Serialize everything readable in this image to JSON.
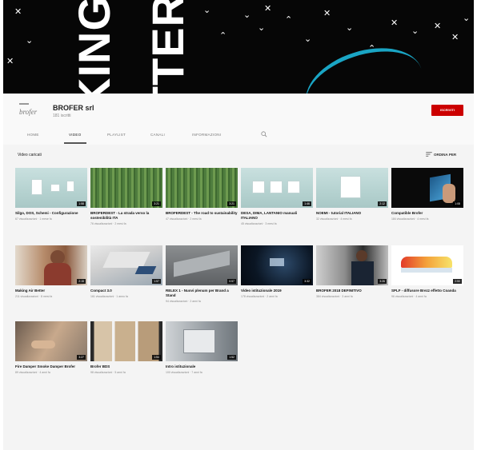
{
  "banner": {
    "text_left": "KING",
    "text_right": "TTER",
    "accent": "#1aa5c4"
  },
  "channel": {
    "logo_text": "brofer",
    "name": "BROFER srl",
    "subscribers": "181 iscritti",
    "subscribe_label": "ISCRIVITI",
    "subscribe_color": "#cc0000"
  },
  "tabs": [
    {
      "label": "HOME"
    },
    {
      "label": "VIDEO"
    },
    {
      "label": "PLAYLIST"
    },
    {
      "label": "CANALI"
    },
    {
      "label": "INFORMAZIONI"
    }
  ],
  "active_tab": "VIDEO",
  "section": {
    "title": "Video caricati",
    "sort_label": "ORDINA PER"
  },
  "videos": [
    {
      "title": "Silgo, DOS, Schemi - Configurazione",
      "meta": "67 visualizzazioni · 1 mese fa",
      "duration": "1:58",
      "thumb": "teal"
    },
    {
      "title": "BROFERDEST - La strada verso la sostenibilità ITA",
      "meta": "76 visualizzazioni · 2 mesi fa",
      "duration": "3:21",
      "thumb": "green"
    },
    {
      "title": "BROFERDEST - The road to sustainability",
      "meta": "47 visualizzazioni · 2 mesi fa",
      "duration": "3:21",
      "thumb": "green"
    },
    {
      "title": "DESA, DIMA, LANTANIO manuali ITALIANO",
      "meta": "45 visualizzazioni · 3 mesi fa",
      "duration": "1:46",
      "thumb": "teal"
    },
    {
      "title": "NOEMI - tutorial ITALIANO",
      "meta": "32 visualizzazioni · 4 mesi fa",
      "duration": "2:12",
      "thumb": "teal"
    },
    {
      "title": "Compatible Brofer",
      "meta": "184 visualizzazioni · 4 mesi fa",
      "duration": "1:08",
      "thumb": "dark"
    },
    {
      "title": "Making Air Better",
      "meta": "211 visualizzazioni · 8 mesi fa",
      "duration": "2:15",
      "thumb": "room"
    },
    {
      "title": "Compact 3.0",
      "meta": "161 visualizzazioni · 1 anno fa",
      "duration": "1:57",
      "thumb": "iso"
    },
    {
      "title": "RELEX 1 - Nuovi plenum per Brand a Stand",
      "meta": "94 visualizzazioni · 2 anni fa",
      "duration": "0:57",
      "thumb": "grey"
    },
    {
      "title": "Video istituzionale 2019",
      "meta": "178 visualizzazioni · 2 anni fa",
      "duration": "3:32",
      "thumb": "night"
    },
    {
      "title": "BROFER 2018 DEFINITIVO",
      "meta": "384 visualizzazioni · 3 anni fa",
      "duration": "3:26",
      "thumb": "lab"
    },
    {
      "title": "SPLF - diffusore Brezz effetto Coanda",
      "meta": "96 visualizzazioni · 4 anni fa",
      "duration": "2:50",
      "thumb": "white"
    },
    {
      "title": "Fire Damper Smoke Damper Brofer",
      "meta": "89 visualizzazioni · 4 anni fa",
      "duration": "3:27",
      "thumb": "hands"
    },
    {
      "title": "Brofer BDS",
      "meta": "98 visualizzazioni · 5 anni fa",
      "duration": "1:54",
      "thumb": "pan"
    },
    {
      "title": "Intro istituzionale",
      "meta": "100 visualizzazioni · 7 anni fa",
      "duration": "1:52",
      "thumb": "fact"
    }
  ]
}
